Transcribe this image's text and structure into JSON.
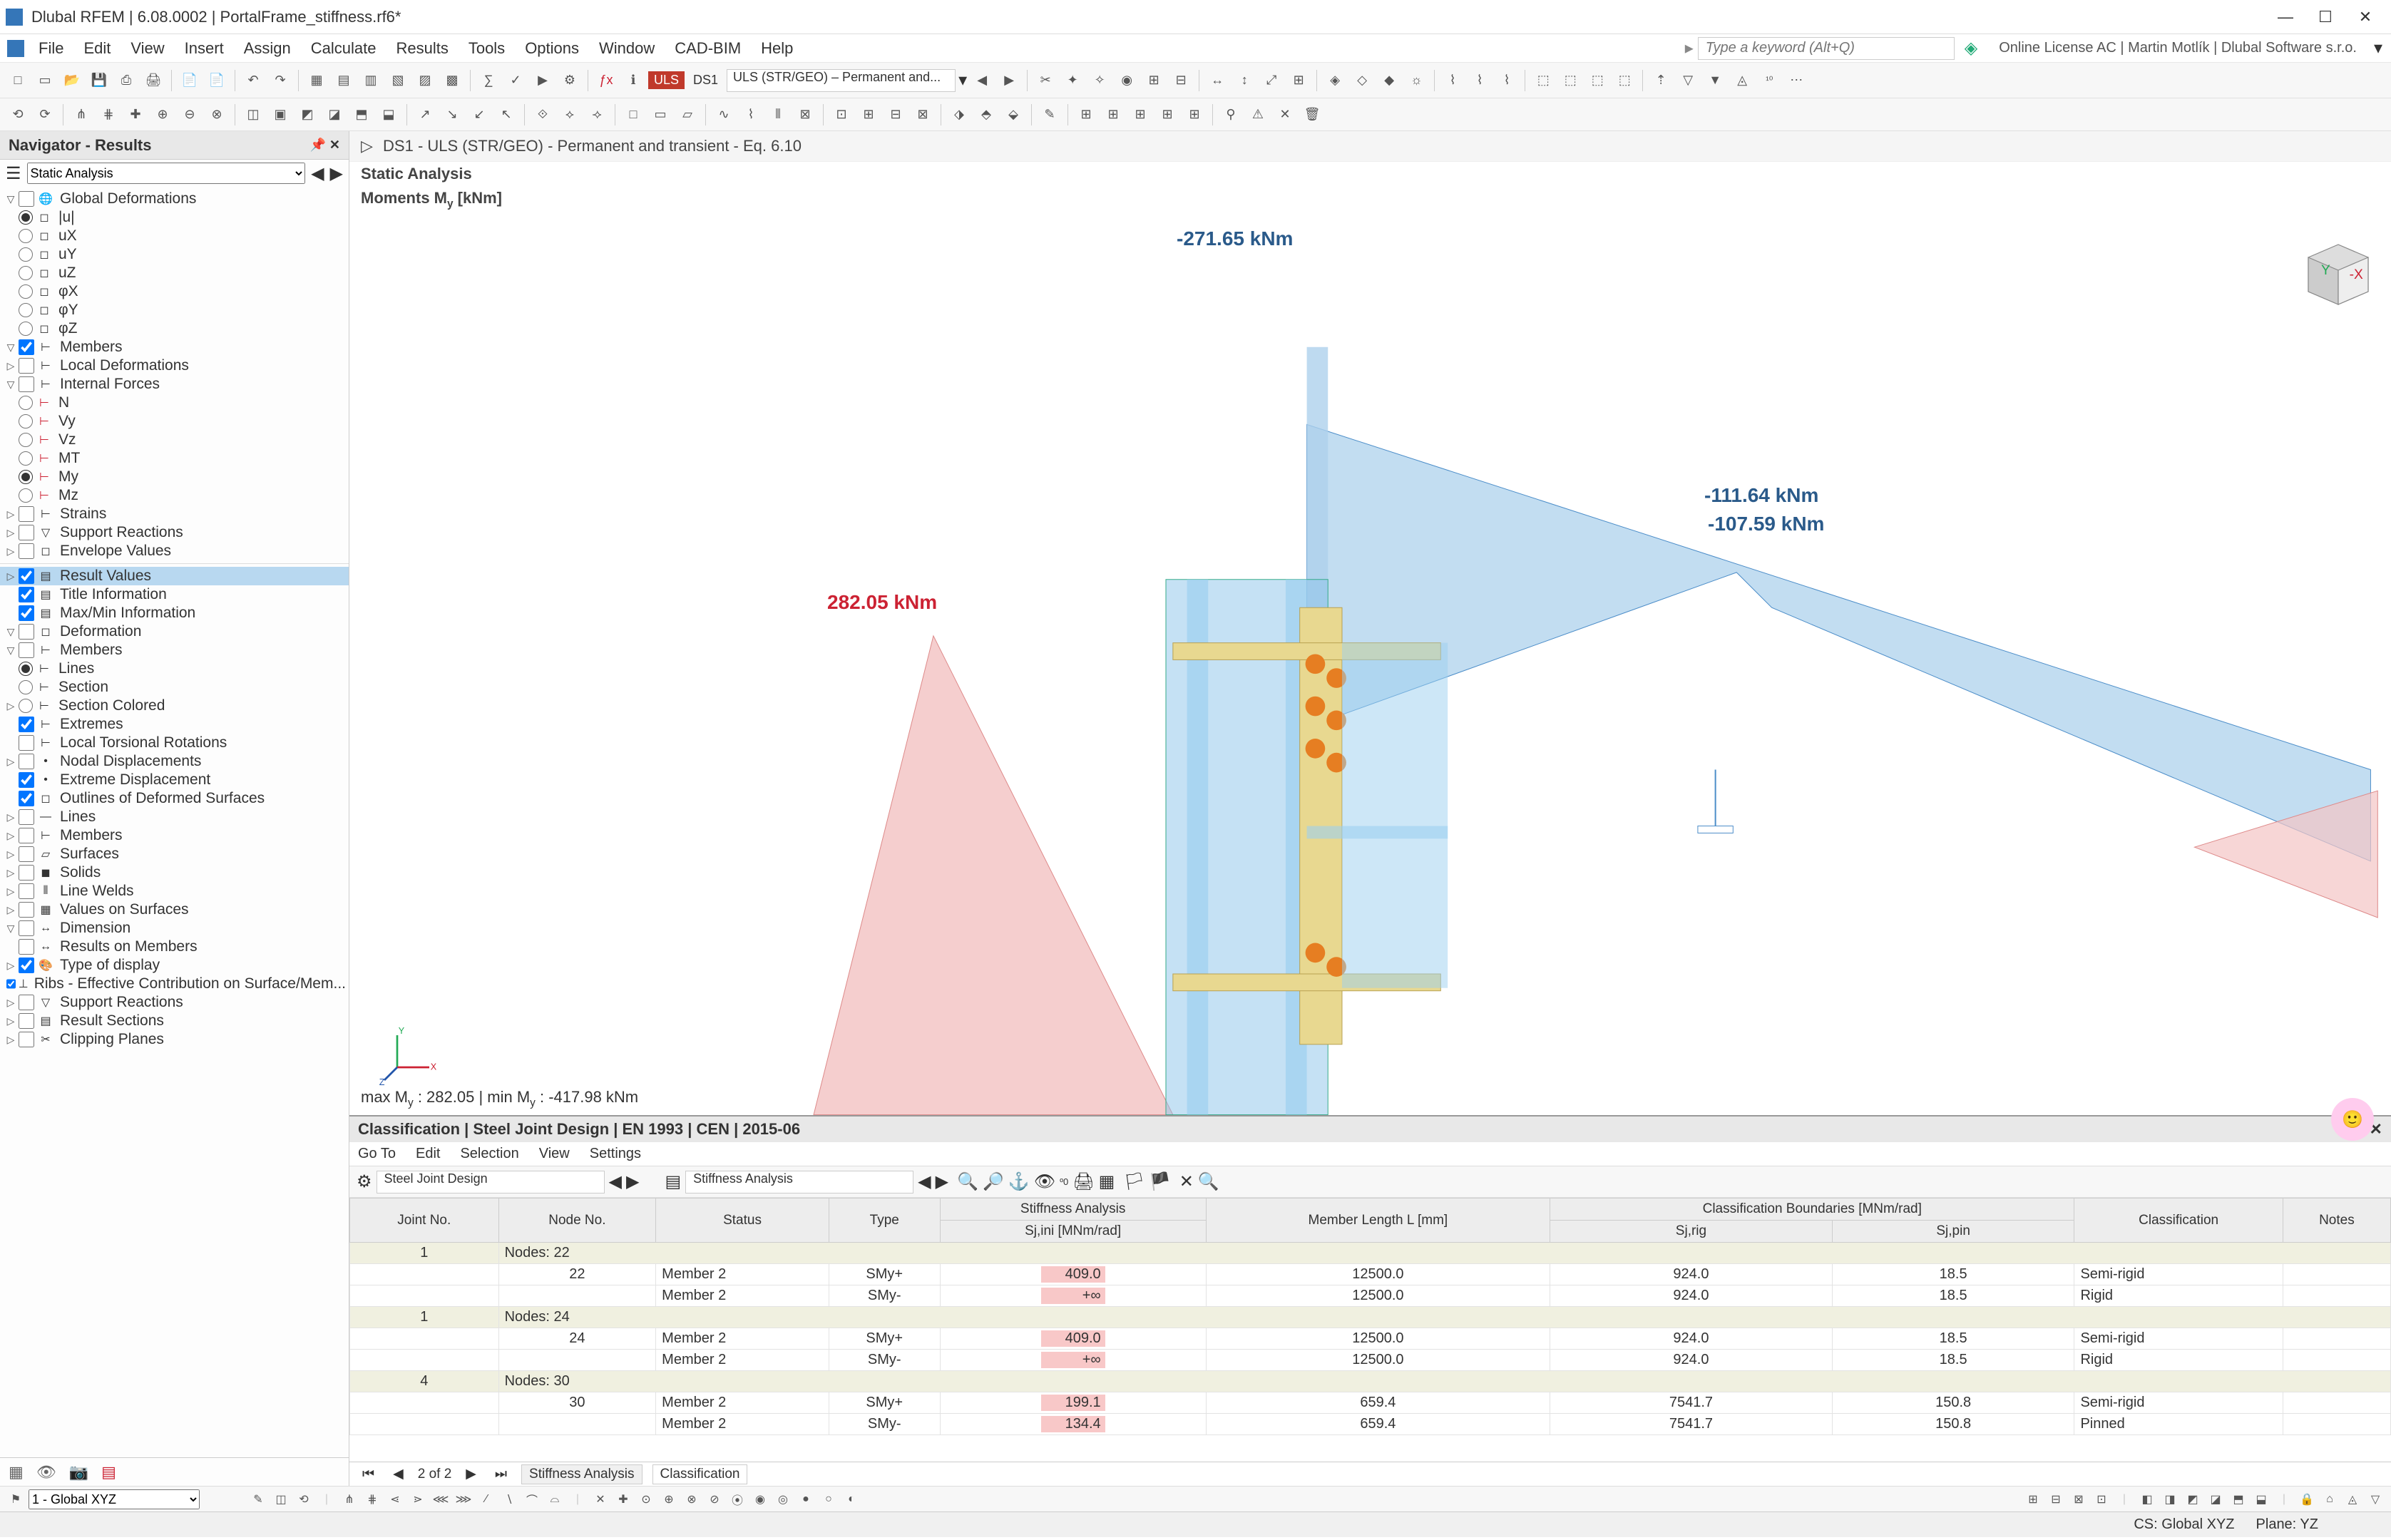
{
  "window": {
    "title": "Dlubal RFEM | 6.08.0002 | PortalFrame_stiffness.rf6*",
    "search_placeholder": "Type a keyword (Alt+Q)",
    "license": "Online License AC | Martin Motlík | Dlubal Software s.r.o.",
    "min": "—",
    "max": "☐",
    "close": "✕"
  },
  "menu": [
    "File",
    "Edit",
    "View",
    "Insert",
    "Assign",
    "Calculate",
    "Results",
    "Tools",
    "Options",
    "Window",
    "CAD-BIM",
    "Help"
  ],
  "designcombo": {
    "uls": "ULS",
    "ds": "DS1",
    "combo": "ULS (STR/GEO) – Permanent and..."
  },
  "navigator": {
    "title": "Navigator - Results",
    "filter": "Static Analysis",
    "tree1": {
      "global_def": "Global Deformations",
      "u_abs": "|u|",
      "ux": "uX",
      "uy": "uY",
      "uz": "uZ",
      "phix": "φX",
      "phiy": "φY",
      "phiz": "φZ",
      "members": "Members",
      "local_def": "Local Deformations",
      "internal": "Internal Forces",
      "N": "N",
      "Vy": "Vy",
      "Vz": "Vz",
      "Mt": "MT",
      "My": "My",
      "Mz": "Mz",
      "strains": "Strains",
      "support": "Support Reactions",
      "envelope": "Envelope Values"
    },
    "tree2": {
      "result_values": "Result Values",
      "title_info": "Title Information",
      "maxmin": "Max/Min Information",
      "deformation": "Deformation",
      "members2": "Members",
      "lines2": "Lines",
      "section": "Section",
      "section_col": "Section Colored",
      "extremes": "Extremes",
      "ltr": "Local Torsional Rotations",
      "nodal_disp": "Nodal Displacements",
      "ext_disp": "Extreme Displacement",
      "outlines": "Outlines of Deformed Surfaces",
      "lines": "Lines",
      "members3": "Members",
      "surfaces": "Surfaces",
      "solids": "Solids",
      "line_welds": "Line Welds",
      "val_surf": "Values on Surfaces",
      "dimension": "Dimension",
      "res_members": "Results on Members",
      "type_disp": "Type of display",
      "ribs": "Ribs - Effective Contribution on Surface/Mem...",
      "sup_react": "Support Reactions",
      "res_sect": "Result Sections",
      "clip": "Clipping Planes"
    }
  },
  "viewport": {
    "header": "DS1 - ULS (STR/GEO) - Permanent and transient - Eq. 6.10",
    "sub1": "Static Analysis",
    "sub2_prefix": "Moments M",
    "sub2_sub": "y",
    "sub2_suffix": " [kNm]",
    "v1": "-271.65 kNm",
    "v2": "-111.64 kNm",
    "v3": "-107.59 kNm",
    "v4": "282.05 kNm",
    "maxmin_prefix": "max M",
    "maxmin_mid": " : 282.05 | min M",
    "maxmin_end": " : -417.98 kNm",
    "cube_x": "-X",
    "cube_y": "Y"
  },
  "classification": {
    "title": "Classification | Steel Joint Design | EN 1993 | CEN | 2015-06",
    "menus": [
      "Go To",
      "Edit",
      "Selection",
      "View",
      "Settings"
    ],
    "combo1": "Steel Joint Design",
    "combo2": "Stiffness Analysis",
    "th_joint": "Joint\nNo.",
    "th_node": "Node\nNo.",
    "th_status": "Status",
    "th_type": "Type",
    "th_stiff": "Stiffness Analysis",
    "th_sjini": "Sj,ini [MNm/rad]",
    "th_len": "Member Length\nL [mm]",
    "th_bounds": "Classification Boundaries [MNm/rad]",
    "th_sjrig": "Sj,rig",
    "th_sjpin": "Sj,pin",
    "th_class": "Classification",
    "th_notes": "Notes",
    "groups": [
      {
        "joint": "1",
        "label": "Nodes: 22",
        "rows": [
          {
            "node": "22",
            "status": "Member 2",
            "type": "SMy+",
            "sj": "409.0",
            "len": "12500.0",
            "rig": "924.0",
            "pin": "18.5",
            "class": "Semi-rigid"
          },
          {
            "node": "",
            "status": "Member 2",
            "type": "SMy-",
            "sj": "+∞",
            "len": "12500.0",
            "rig": "924.0",
            "pin": "18.5",
            "class": "Rigid"
          }
        ]
      },
      {
        "joint": "1",
        "label": "Nodes: 24",
        "rows": [
          {
            "node": "24",
            "status": "Member 2",
            "type": "SMy+",
            "sj": "409.0",
            "len": "12500.0",
            "rig": "924.0",
            "pin": "18.5",
            "class": "Semi-rigid"
          },
          {
            "node": "",
            "status": "Member 2",
            "type": "SMy-",
            "sj": "+∞",
            "len": "12500.0",
            "rig": "924.0",
            "pin": "18.5",
            "class": "Rigid"
          }
        ]
      },
      {
        "joint": "4",
        "label": "Nodes: 30",
        "rows": [
          {
            "node": "30",
            "status": "Member 2",
            "type": "SMy+",
            "sj": "199.1",
            "len": "659.4",
            "rig": "7541.7",
            "pin": "150.8",
            "class": "Semi-rigid"
          },
          {
            "node": "",
            "status": "Member 2",
            "type": "SMy-",
            "sj": "134.4",
            "len": "659.4",
            "rig": "7541.7",
            "pin": "150.8",
            "class": "Pinned"
          }
        ]
      }
    ],
    "pager": {
      "pos": "2 of 2",
      "tabs": [
        "Stiffness Analysis",
        "Classification"
      ]
    }
  },
  "status": {
    "global": "1 - Global XYZ",
    "cs": "CS: Global XYZ",
    "plane": "Plane: YZ"
  }
}
